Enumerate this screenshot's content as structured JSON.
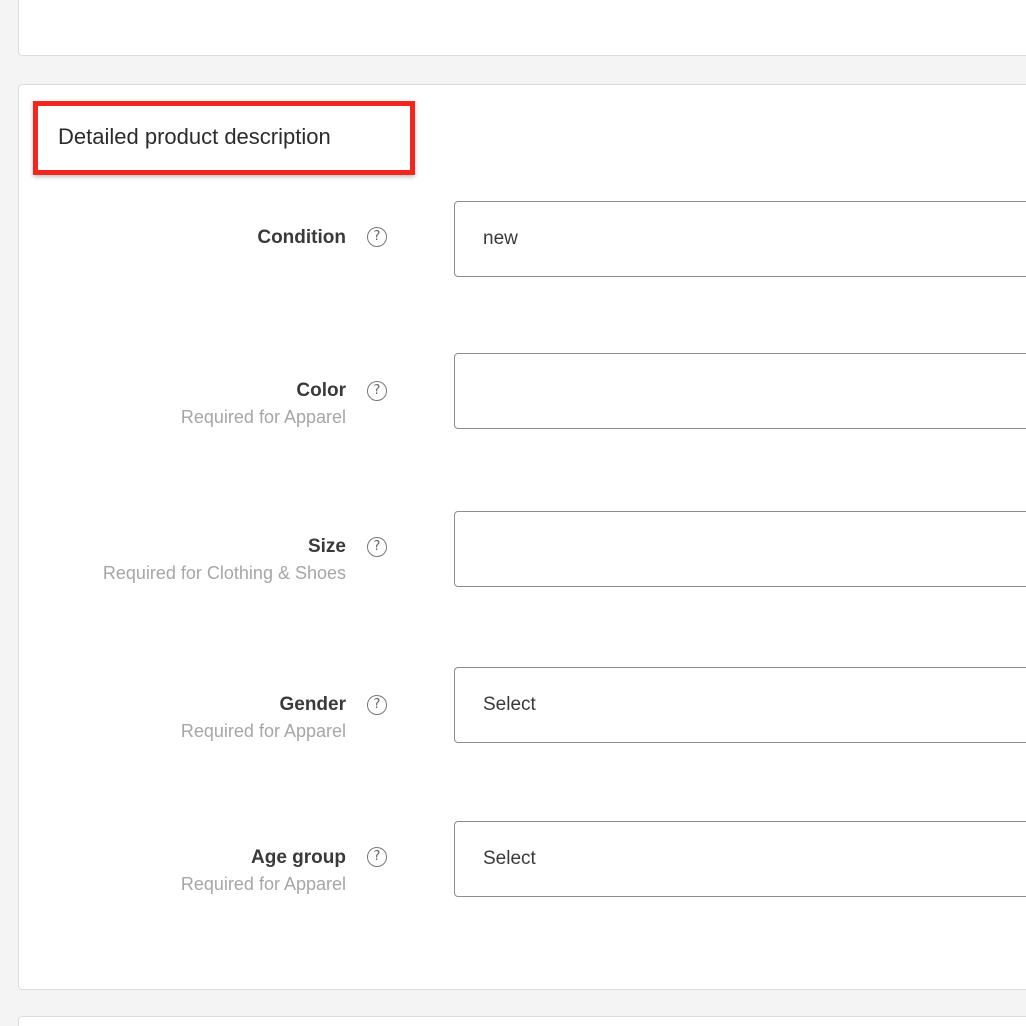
{
  "section": {
    "title": "Detailed product description"
  },
  "fields": [
    {
      "label": "Condition",
      "hint": "",
      "value": "new"
    },
    {
      "label": "Color",
      "hint": "Required for Apparel",
      "value": ""
    },
    {
      "label": "Size",
      "hint": "Required for Clothing & Shoes",
      "value": ""
    },
    {
      "label": "Gender",
      "hint": "Required for Apparel",
      "value": "Select"
    },
    {
      "label": "Age group",
      "hint": "Required for Apparel",
      "value": "Select"
    }
  ],
  "help_icon_glyph": "?",
  "colors": {
    "highlight": "#f0261f",
    "page_bg": "#f4f4f4",
    "hint_text": "#a6a6a6"
  }
}
